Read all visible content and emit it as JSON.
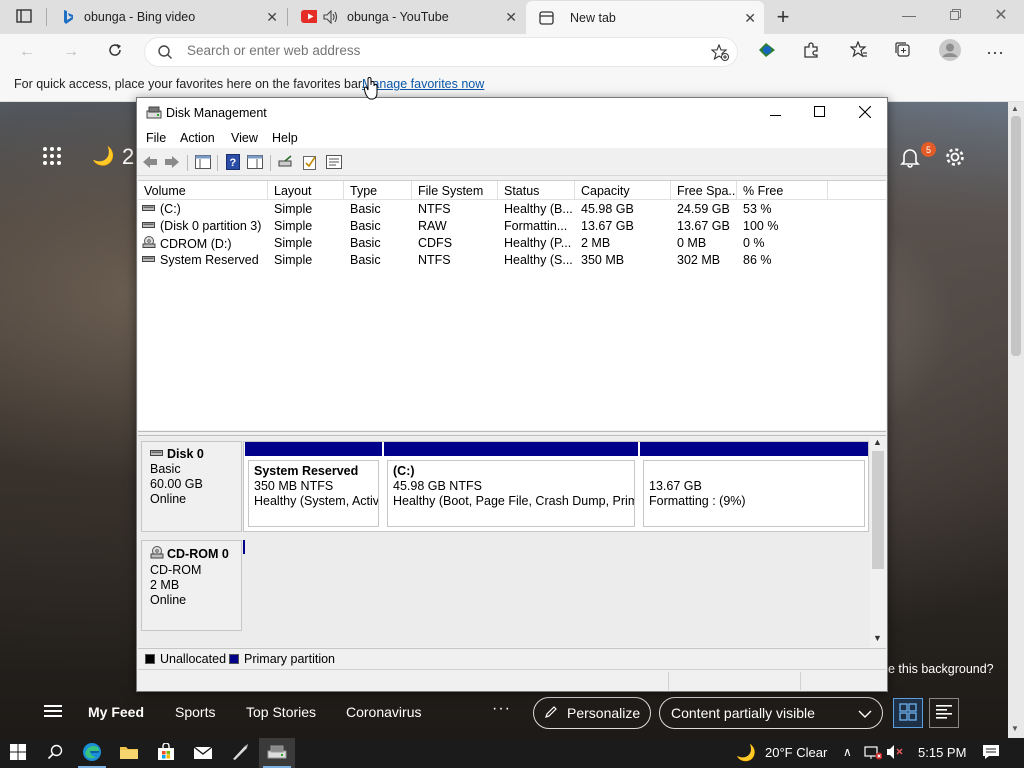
{
  "browser": {
    "tabs": [
      {
        "title": "obunga - Bing video"
      },
      {
        "title": "obunga - YouTube"
      },
      {
        "title": "New tab"
      }
    ],
    "address_placeholder": "Search or enter web address",
    "favorites_prompt": "For quick access, place your favorites here on the favorites bar.",
    "favorites_link": "Manage favorites now"
  },
  "new_tab_page": {
    "weather_partial": "2",
    "notification_count": "5",
    "background_question": "e this background?",
    "feed": {
      "my_feed": "My Feed",
      "sports": "Sports",
      "top_stories": "Top Stories",
      "coronavirus": "Coronavirus",
      "more": "···",
      "personalize": "Personalize",
      "content_visibility": "Content partially visible"
    }
  },
  "disk_management": {
    "title": "Disk Management",
    "menu": [
      "File",
      "Action",
      "View",
      "Help"
    ],
    "columns": [
      "Volume",
      "Layout",
      "Type",
      "File System",
      "Status",
      "Capacity",
      "Free Spa...",
      "% Free"
    ],
    "volumes": [
      {
        "volume": "(C:)",
        "layout": "Simple",
        "type": "Basic",
        "fs": "NTFS",
        "status": "Healthy (B...",
        "capacity": "45.98 GB",
        "free": "24.59 GB",
        "pct": "53 %",
        "icon": "hdd-icon"
      },
      {
        "volume": "(Disk 0 partition 3)",
        "layout": "Simple",
        "type": "Basic",
        "fs": "RAW",
        "status": "Formattin...",
        "capacity": "13.67 GB",
        "free": "13.67 GB",
        "pct": "100 %",
        "icon": "hdd-icon"
      },
      {
        "volume": "CDROM (D:)",
        "layout": "Simple",
        "type": "Basic",
        "fs": "CDFS",
        "status": "Healthy (P...",
        "capacity": "2 MB",
        "free": "0 MB",
        "pct": "0 %",
        "icon": "cd-icon"
      },
      {
        "volume": "System Reserved",
        "layout": "Simple",
        "type": "Basic",
        "fs": "NTFS",
        "status": "Healthy (S...",
        "capacity": "350 MB",
        "free": "302 MB",
        "pct": "86 %",
        "icon": "hdd-icon"
      }
    ],
    "disks": [
      {
        "name": "Disk 0",
        "type": "Basic",
        "size": "60.00 GB",
        "state": "Online",
        "partitions": [
          {
            "name": "System Reserved",
            "line1": "350 MB NTFS",
            "line2": "Healthy (System, Active"
          },
          {
            "name": "(C:)",
            "line1": "45.98 GB NTFS",
            "line2": "Healthy (Boot, Page File, Crash Dump, Primar"
          },
          {
            "name": "",
            "line1": "13.67 GB",
            "line2": "Formatting : (9%)"
          }
        ]
      },
      {
        "name": "CD-ROM 0",
        "type": "CD-ROM",
        "size": "2 MB",
        "state": "Online"
      }
    ],
    "legend": [
      {
        "label": "Unallocated",
        "color": "#000000"
      },
      {
        "label": "Primary partition",
        "color": "#00008b"
      }
    ]
  },
  "taskbar": {
    "weather": "20°F  Clear",
    "time": "5:15 PM"
  },
  "colors": {
    "partition_bar": "#00008b",
    "link": "#0b57a8",
    "notification_badge": "#e35b26"
  }
}
